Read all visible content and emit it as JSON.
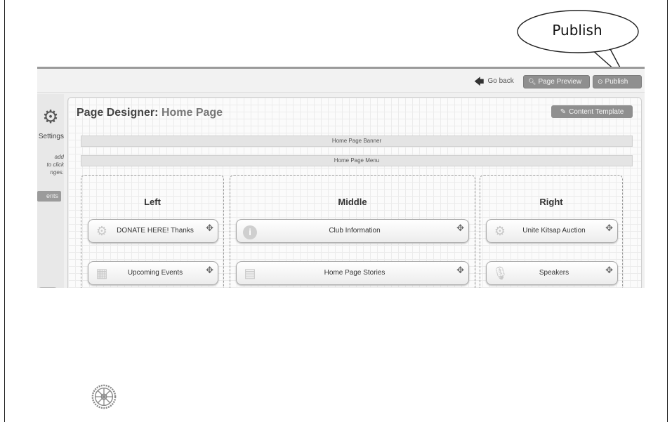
{
  "callout": {
    "text": "Publish"
  },
  "topbar": {
    "go_back": "Go back",
    "page_preview": "Page Preview",
    "publish": "Publish",
    "icons": {
      "go_back": "arrow-left-icon",
      "preview": "magnifier-icon",
      "publish": "check-circle-icon"
    }
  },
  "settings": {
    "label": "Settings",
    "help_lines": [
      "add",
      "to click",
      "nges."
    ],
    "button": "ents"
  },
  "designer": {
    "title_prefix": "Page Designer:",
    "page_name": "Home Page",
    "content_template": "Content Template",
    "banner": "Home Page Banner",
    "menu": "Home Page Menu"
  },
  "columns": {
    "left": {
      "heading": "Left",
      "widgets": [
        {
          "label": "DONATE HERE! Thanks",
          "icon": "gears-icon"
        },
        {
          "label": "Upcoming Events",
          "icon": "calendar-icon"
        }
      ]
    },
    "middle": {
      "heading": "Middle",
      "widgets": [
        {
          "label": "Club Information",
          "icon": "info-icon"
        },
        {
          "label": "Home Page Stories",
          "icon": "document-icon"
        }
      ]
    },
    "right": {
      "heading": "Right",
      "widgets": [
        {
          "label": "Unite Kitsap Auction",
          "icon": "gears-icon"
        },
        {
          "label": "Speakers",
          "icon": "microphone-icon"
        }
      ]
    }
  },
  "colors": {
    "button_gray": "#8f8f8f",
    "panel_bg": "#fbfbfb",
    "grid": "#ececec"
  }
}
